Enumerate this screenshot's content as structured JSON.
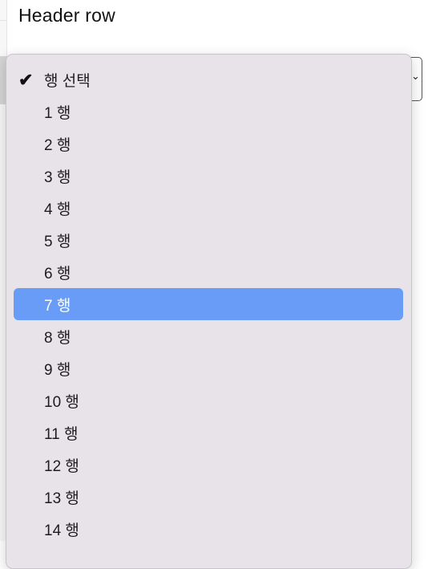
{
  "section": {
    "title": "Header row"
  },
  "select": {
    "selected_value": "행 선택",
    "highlighted_index": 7,
    "options": [
      {
        "label": "행 선택",
        "checked": true
      },
      {
        "label": "1 행",
        "checked": false
      },
      {
        "label": "2 행",
        "checked": false
      },
      {
        "label": "3 행",
        "checked": false
      },
      {
        "label": "4 행",
        "checked": false
      },
      {
        "label": "5 행",
        "checked": false
      },
      {
        "label": "6 행",
        "checked": false
      },
      {
        "label": "7 행",
        "checked": false
      },
      {
        "label": "8 행",
        "checked": false
      },
      {
        "label": "9 행",
        "checked": false
      },
      {
        "label": "10 행",
        "checked": false
      },
      {
        "label": "11 행",
        "checked": false
      },
      {
        "label": "12 행",
        "checked": false
      },
      {
        "label": "13 행",
        "checked": false
      },
      {
        "label": "14 행",
        "checked": false
      }
    ],
    "check_glyph": "✔",
    "chevron_glyph": "⌄"
  },
  "colors": {
    "highlight": "#689cf6",
    "menu_bg": "#e8e3e9"
  }
}
